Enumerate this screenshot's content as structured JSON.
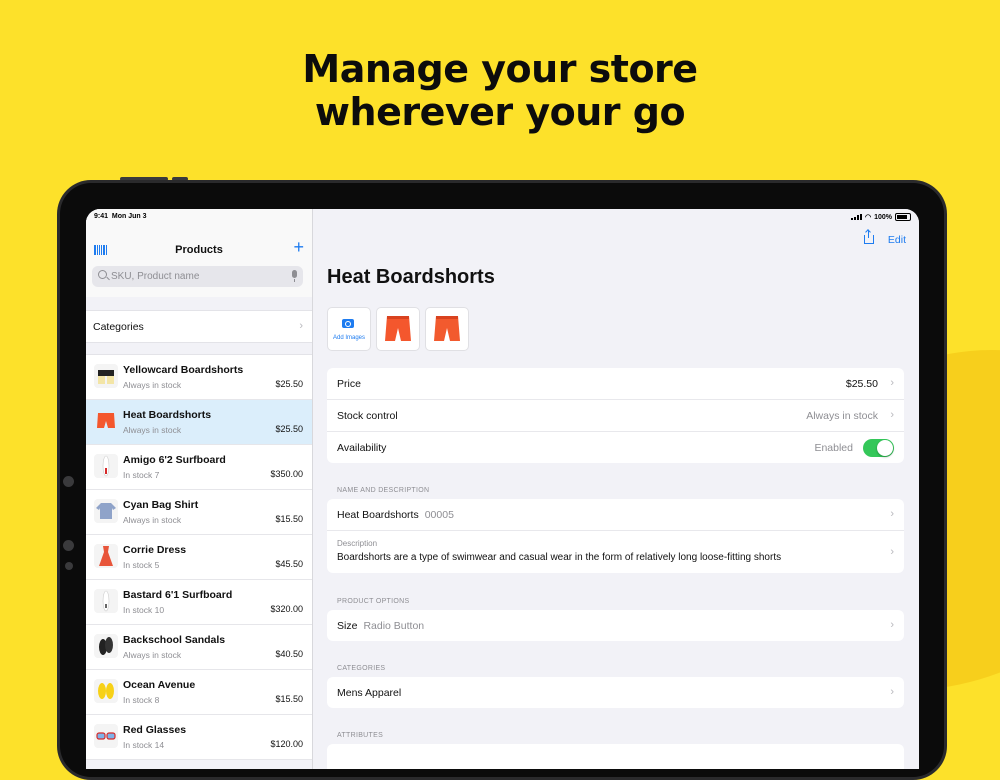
{
  "headline": {
    "line1": "Manage your store",
    "line2": "wherever your go"
  },
  "colors": {
    "background": "#fde12a",
    "accent": "#1e7cf0",
    "toggle_on": "#34c759",
    "selection": "#dbeefb"
  },
  "status_bar": {
    "time": "9:41",
    "date": "Mon Jun 3",
    "battery": "100%"
  },
  "sidebar": {
    "title": "Products",
    "left_icon": "barcode-icon",
    "right_icon": "plus-icon",
    "search_placeholder": "SKU, Product name",
    "categories_label": "Categories",
    "products": [
      {
        "name": "Yellowcard Boardshorts",
        "stock": "Always in stock",
        "price": "$25.50",
        "selected": false
      },
      {
        "name": "Heat Boardshorts",
        "stock": "Always in stock",
        "price": "$25.50",
        "selected": true
      },
      {
        "name": "Amigo 6'2 Surfboard",
        "stock": "In stock 7",
        "price": "$350.00",
        "selected": false
      },
      {
        "name": "Cyan Bag Shirt",
        "stock": "Always in stock",
        "price": "$15.50",
        "selected": false
      },
      {
        "name": "Corrie Dress",
        "stock": "In stock 5",
        "price": "$45.50",
        "selected": false
      },
      {
        "name": "Bastard 6'1 Surfboard",
        "stock": "In stock 10",
        "price": "$320.00",
        "selected": false
      },
      {
        "name": "Backschool Sandals",
        "stock": "Always in stock",
        "price": "$40.50",
        "selected": false
      },
      {
        "name": "Ocean Avenue",
        "stock": "In stock 8",
        "price": "$15.50",
        "selected": false
      },
      {
        "name": "Red Glasses",
        "stock": "In stock 14",
        "price": "$120.00",
        "selected": false
      }
    ]
  },
  "detail": {
    "edit_label": "Edit",
    "title": "Heat Boardshorts",
    "add_images_label": "Add Images",
    "price_label": "Price",
    "price_value": "$25.50",
    "stock_label": "Stock control",
    "stock_value": "Always in stock",
    "availability_label": "Availability",
    "availability_value": "Enabled",
    "availability_on": true,
    "name_section": "NAME AND DESCRIPTION",
    "name_value": "Heat Boardshorts",
    "sku_value": "00005",
    "description_label": "Description",
    "description_text": "Boardshorts are a type of swimwear and casual wear in the form of relatively long loose-fitting shorts",
    "options_section": "PRODUCT OPTIONS",
    "size_label": "Size",
    "size_value": "Radio Button",
    "categories_section": "CATEGORIES",
    "category_value": "Mens Apparel",
    "attributes_section": "ATTRIBUTES"
  }
}
